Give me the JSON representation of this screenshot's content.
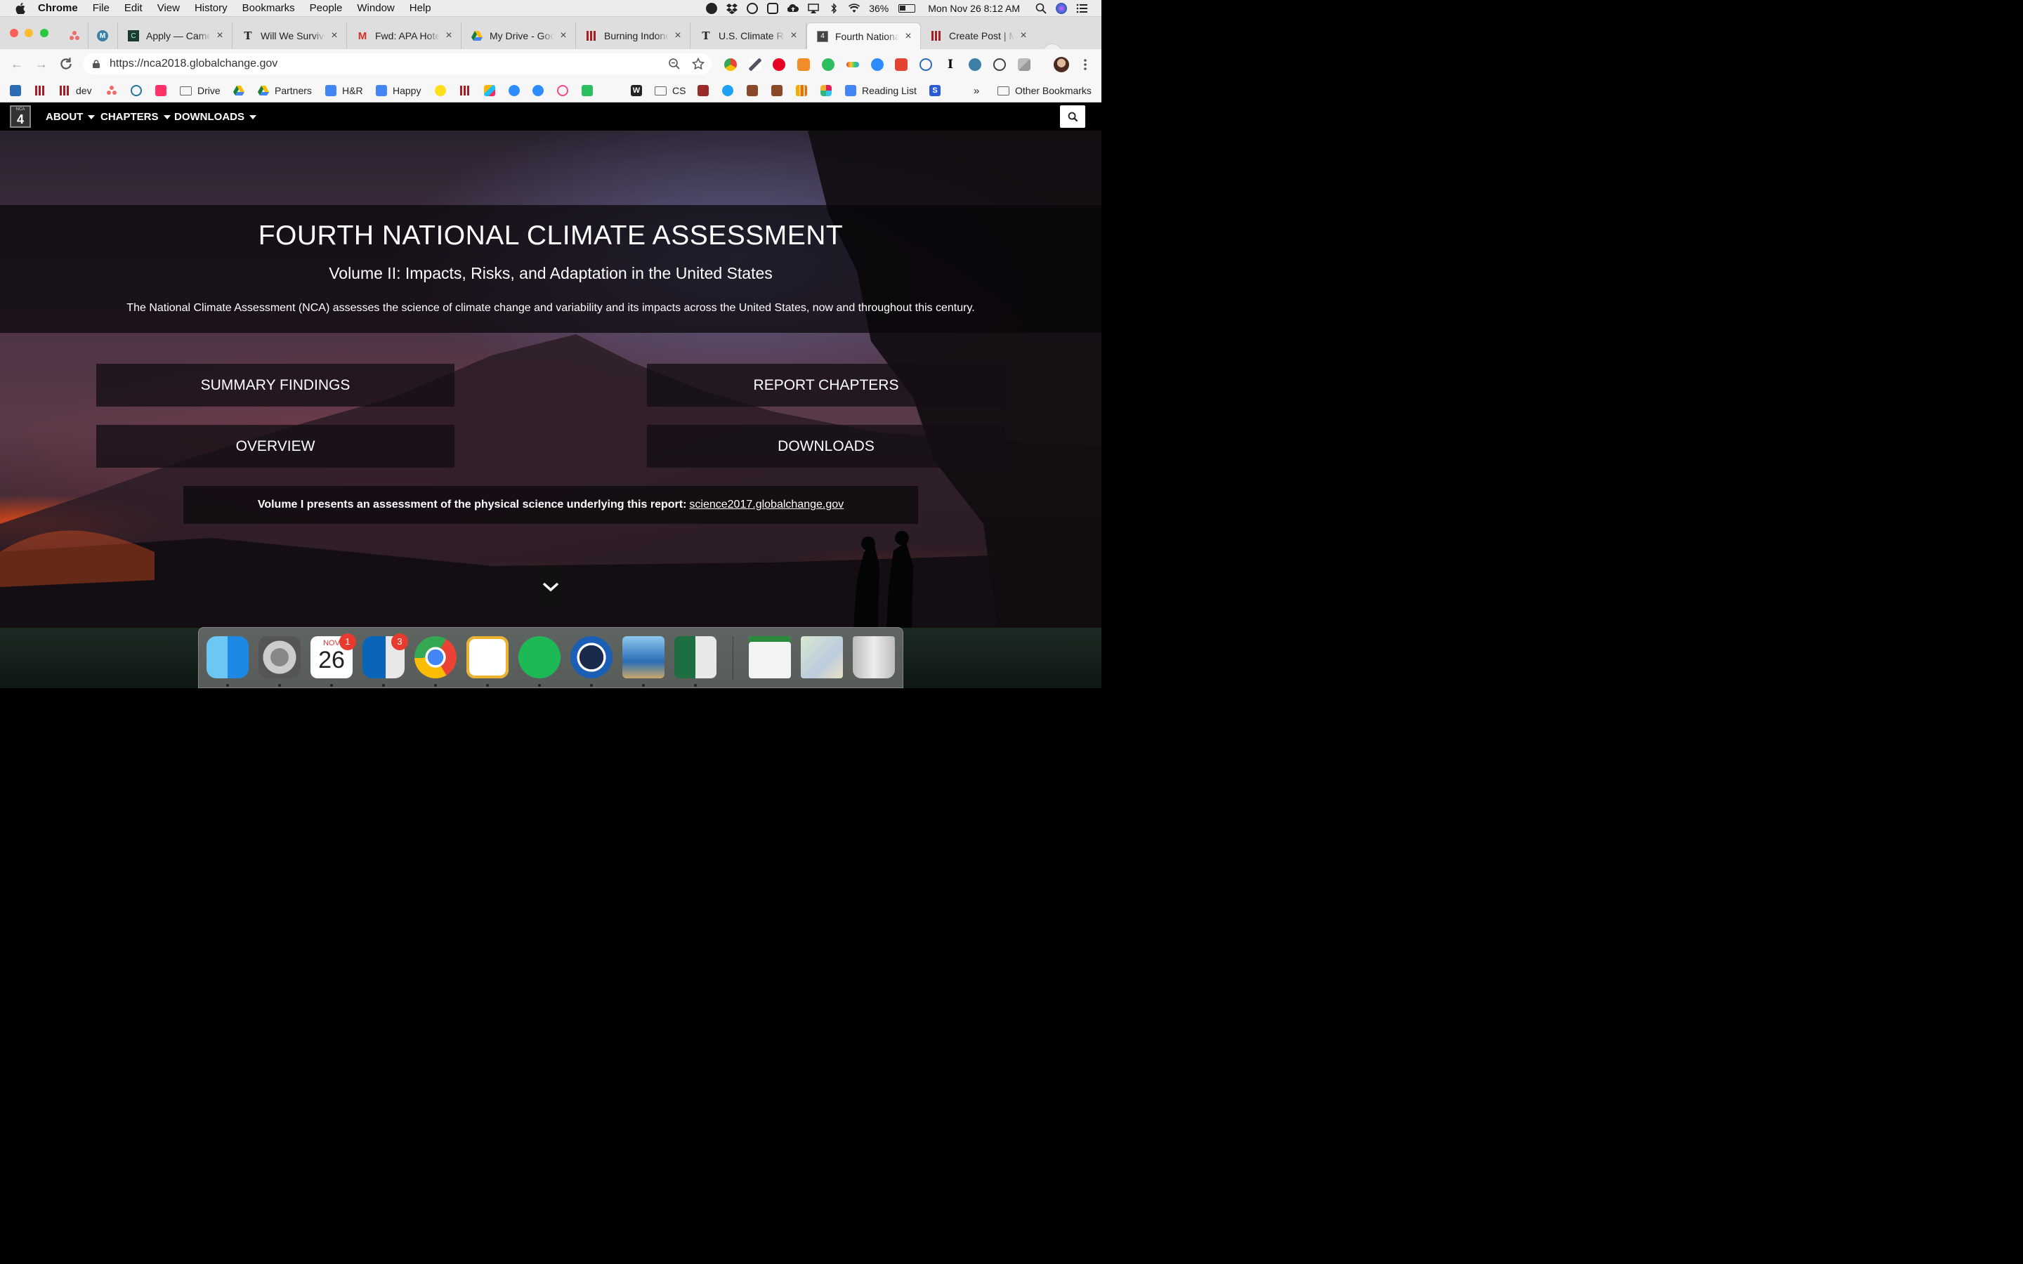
{
  "menubar": {
    "app": "Chrome",
    "items": [
      "File",
      "Edit",
      "View",
      "History",
      "Bookmarks",
      "People",
      "Window",
      "Help"
    ],
    "battery": "36%",
    "clock": "Mon Nov 26  8:12 AM"
  },
  "tabs": [
    {
      "title": ""
    },
    {
      "title": ""
    },
    {
      "title": "Apply — Camel"
    },
    {
      "title": "Will We Survive"
    },
    {
      "title": "Fwd: APA Hotel"
    },
    {
      "title": "My Drive - Goo"
    },
    {
      "title": "Burning Indone"
    },
    {
      "title": "U.S. Climate Re"
    },
    {
      "title": "Fourth National"
    },
    {
      "title": "Create Post | M"
    }
  ],
  "toolbar": {
    "url": "https://nca2018.globalchange.gov"
  },
  "bookmarks": {
    "dev": "dev",
    "drive": "Drive",
    "partners": "Partners",
    "hr": "H&R",
    "happy": "Happy",
    "cs": "CS",
    "reading_list": "Reading List",
    "overflow": "»",
    "other": "Other Bookmarks"
  },
  "sitenav": {
    "logo_small": "NCA",
    "logo_number": "4",
    "about": "ABOUT",
    "chapters": "CHAPTERS",
    "downloads": "DOWNLOADS"
  },
  "hero": {
    "title": "FOURTH NATIONAL CLIMATE ASSESSMENT",
    "subtitle": "Volume II: Impacts, Risks, and Adaptation in the United States",
    "description": "The National Climate Assessment (NCA) assesses the science of climate change and variability and its impacts across the United States, now and throughout this century.",
    "buttons": {
      "summary": "SUMMARY FINDINGS",
      "chapters": "REPORT CHAPTERS",
      "overview": "OVERVIEW",
      "downloads": "DOWNLOADS"
    },
    "volume1_text": "Volume I presents an assessment of the physical science underlying this report:",
    "volume1_link": "science2017.globalchange.gov"
  },
  "dock": {
    "calendar_month": "NOV",
    "calendar_day": "26",
    "calendar_badge": "1",
    "outlook_badge": "3"
  },
  "colors": {
    "nav_bg": "#000000",
    "overlay": "#0e0a0e",
    "fire": "#ff5a1e"
  }
}
